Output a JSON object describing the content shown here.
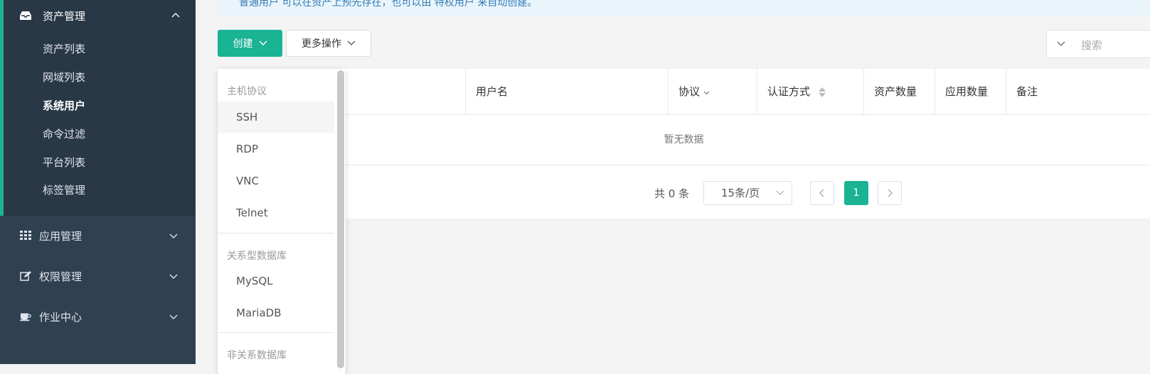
{
  "sidebar": {
    "asset_mgmt": {
      "label": "资产管理",
      "icon": "inbox-icon"
    },
    "asset_items": [
      "资产列表",
      "网域列表",
      "系统用户",
      "命令过滤",
      "平台列表",
      "标签管理"
    ],
    "active_item": "系统用户",
    "app_mgmt": {
      "label": "应用管理",
      "icon": "grid-icon"
    },
    "perm_mgmt": {
      "label": "权限管理",
      "icon": "edit-icon"
    },
    "job_center": {
      "label": "作业中心",
      "icon": "coffee-icon"
    }
  },
  "notice": {
    "text": "普通用户 可以在资产上预先存在，也可以由 特权用户 来自动创建。"
  },
  "toolbar": {
    "create_label": "创建",
    "more_label": "更多操作",
    "search_placeholder": "搜索"
  },
  "table": {
    "columns": [
      "用户名",
      "协议",
      "认证方式",
      "资产数量",
      "应用数量",
      "备注"
    ],
    "empty_text": "暂无数据"
  },
  "pagination": {
    "total": "共 0 条",
    "page_size": "15条/页",
    "current_page": "1"
  },
  "dropdown": {
    "group_host": "主机协议",
    "host_items": [
      "SSH",
      "RDP",
      "VNC",
      "Telnet"
    ],
    "group_rdb": "关系型数据库",
    "rdb_items": [
      "MySQL",
      "MariaDB"
    ],
    "group_nonrdb": "非关系数据库"
  },
  "colors": {
    "accent": "#1ab394",
    "sidebar_bg": "#2f4050",
    "sidebar_sub_bg": "#293846"
  }
}
